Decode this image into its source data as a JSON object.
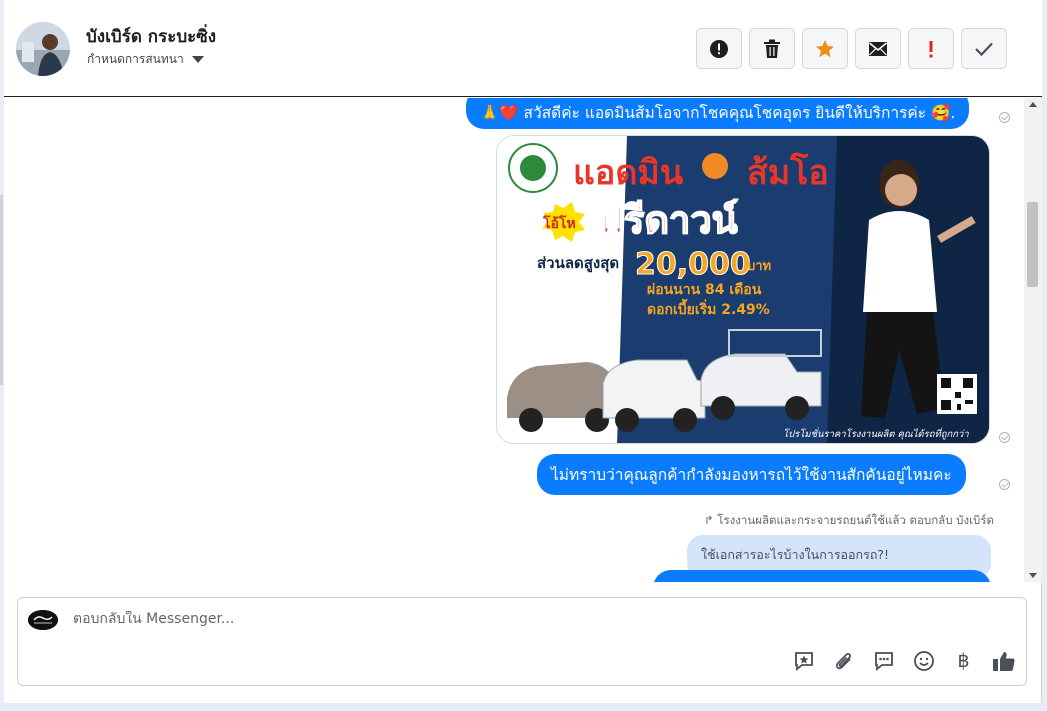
{
  "header": {
    "contact_name": "บังเบิร์ด กระบะซิ่ง",
    "assign_label": "กำหนดการสนทนา",
    "actions": [
      {
        "name": "spam-button",
        "icon": "alert-circle-icon"
      },
      {
        "name": "delete-button",
        "icon": "trash-icon"
      },
      {
        "name": "star-button",
        "icon": "star-icon"
      },
      {
        "name": "mark-unread-button",
        "icon": "envelope-icon"
      },
      {
        "name": "follow-up-button",
        "icon": "exclamation-icon"
      },
      {
        "name": "mark-done-button",
        "icon": "checkmark-icon"
      }
    ]
  },
  "messages": {
    "greeting": "🙏❤️ สวัสดีค่ะ แอดมินส้มโอจากโชคคุณโชคอุดร ยินดีให้บริการค่ะ 🥰.",
    "question": "ไม่ทราบว่าคุณลูกค้ากำลังมองหารถไว้ใช้งานสักคันอยู่ไหมคะ",
    "reply_note": "โรงงานผลิตและกระจายรถยนต์ใช้แล้ว ตอบกลับ บังเบิร์ด",
    "quoted_reply": "ใช้เอกสารอะไรบ้างในการออกรถ?!"
  },
  "ad_image": {
    "headline": "แอดมิน",
    "headline2": "ส้มโอ",
    "badge": "โอ้โห",
    "free_down": "ฟรีดาวน์",
    "discount_label": "ส่วนลดสูงสุด",
    "discount_amount": "20,000",
    "currency": "บาท",
    "installment": "ผ่อนนาน 84 เดือน",
    "interest": "ดอกเบี้ยเริ่ม 2.49%",
    "footer": "โปรโมชั่นราคาโรงงานผลิต คุณได้รถที่ถูกกว่า",
    "colors": {
      "headline": "#e8372a",
      "price": "#f5a623",
      "blue_bg": "#1a3c6e"
    }
  },
  "composer": {
    "placeholder": "ตอบกลับใน Messenger...",
    "tools": [
      "saved-reply-icon",
      "attachment-icon",
      "chat-bubble-icon",
      "emoji-icon",
      "baht-payment-icon",
      "thumbs-up-icon"
    ],
    "baht_symbol": "฿"
  },
  "colors": {
    "accent": "#0a7cff",
    "star": "#f28b1b",
    "alert": "#e02424"
  }
}
